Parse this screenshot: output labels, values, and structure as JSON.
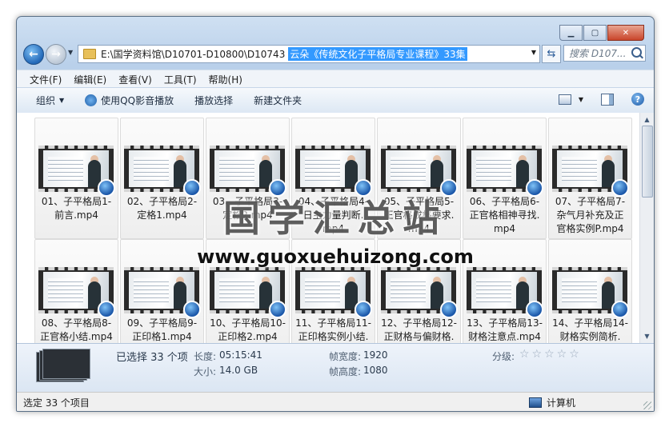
{
  "window": {
    "caption_buttons": {
      "minimize": "▁",
      "maximize": "▢",
      "close": "✕"
    }
  },
  "address_bar": {
    "path": "E:\\国学资料馆\\D10701-D10800\\D10743",
    "path_selected": "云朵《传统文化子平格局专业课程》33集",
    "search_placeholder": "搜索 D107..."
  },
  "menu": [
    "文件(F)",
    "编辑(E)",
    "查看(V)",
    "工具(T)",
    "帮助(H)"
  ],
  "toolbar": {
    "organize": "组织",
    "play_qq": "使用QQ影音播放",
    "play_selection": "播放选择",
    "new_folder": "新建文件夹"
  },
  "files": [
    {
      "label": "01、子平格局1-\n前言.mp4"
    },
    {
      "label": "02、子平格局2-\n定格1.mp4"
    },
    {
      "label": "03、子平格局3-\n定格2.mp4"
    },
    {
      "label": "04、子平格局4-\n日主力量判断.\nmp4"
    },
    {
      "label": "05、子平格局5-\n正官格成格要求.\nmp4"
    },
    {
      "label": "06、子平格局6-\n正官格相神寻找.\nmp4"
    },
    {
      "label": "07、子平格局7-\n杂气月补充及正\n官格实例P.mp4"
    },
    {
      "label": "08、子平格局8-\n正官格小结.mp4"
    },
    {
      "label": "09、子平格局9-\n正印格1.mp4"
    },
    {
      "label": "10、子平格局10-\n正印格2.mp4"
    },
    {
      "label": "11、子平格局11-\n正印格实例小结."
    },
    {
      "label": "12、子平格局12-\n正财格与偏财格."
    },
    {
      "label": "13、子平格局13-\n财格注意点.mp4"
    },
    {
      "label": "14、子平格局14-\n财格实例简析."
    }
  ],
  "watermark": {
    "cn": "国学汇总站",
    "url": "www.guoxuehuizong.com"
  },
  "details": {
    "selected": "已选择 33 个项",
    "length_label": "长度:",
    "length_value": "05:15:41",
    "size_label": "大小:",
    "size_value": "14.0 GB",
    "frame_width_label": "帧宽度:",
    "frame_width_value": "1920",
    "frame_height_label": "帧高度:",
    "frame_height_value": "1080",
    "rating_label": "分级:",
    "rating_stars": "☆☆☆☆☆"
  },
  "status": {
    "left": "选定 33 个项目",
    "right": "计算机"
  },
  "colors": {
    "selection": "#3399ff",
    "chrome": "#bed3ec",
    "close": "#c9452b"
  }
}
